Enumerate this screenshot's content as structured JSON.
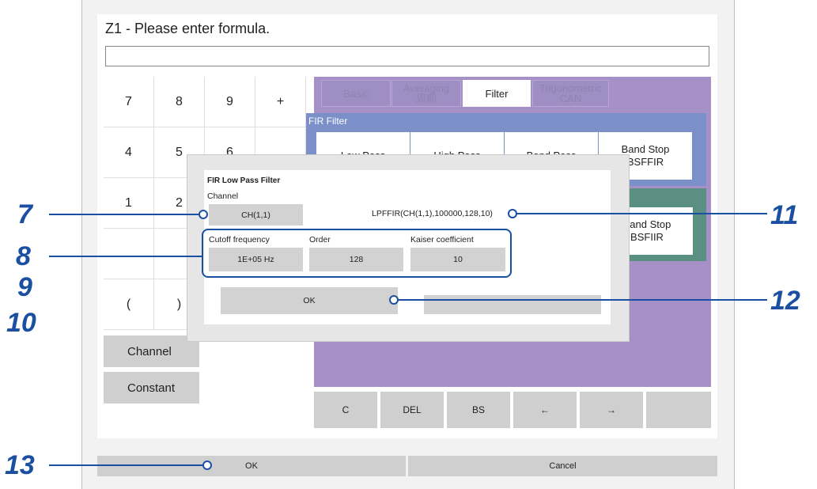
{
  "window": {
    "title": "Z1 - Please enter formula.",
    "formula_value": ""
  },
  "keypad": {
    "keys": [
      "7",
      "8",
      "9",
      "+",
      "4",
      "5",
      "6",
      "",
      "1",
      "2",
      "",
      "",
      "",
      "",
      "",
      "",
      "(",
      ")"
    ]
  },
  "side_buttons": {
    "channel": "Channel",
    "constant": "Constant"
  },
  "tabs": [
    {
      "label": "Basic",
      "active": false
    },
    {
      "label": "Averaging\n周期",
      "active": false
    },
    {
      "label": "Filter",
      "active": true
    },
    {
      "label": "Trigonometric\nCAN",
      "active": false
    }
  ],
  "fir_section": {
    "title": "FIR Filter",
    "buttons": [
      "Low Pass",
      "High Pass",
      "Band Pass",
      "Band Stop\nBSFFIR"
    ]
  },
  "iir_section": {
    "buttons": [
      "Band Stop\nBSFIIR"
    ]
  },
  "bottom_keys": [
    "C",
    "DEL",
    "BS",
    "←",
    "→",
    ""
  ],
  "dialog": {
    "title": "FIR Low Pass Filter",
    "channel_label": "Channel",
    "channel_value": "CH(1,1)",
    "formula_preview": "LPFFIR(CH(1,1),100000,128,10)",
    "cutoff_label": "Cutoff frequency",
    "cutoff_value": "1E+05 Hz",
    "order_label": "Order",
    "order_value": "128",
    "kaiser_label": "Kaiser coefficient",
    "kaiser_value": "10",
    "ok_label": "OK",
    "cancel_label": ""
  },
  "footer": {
    "ok_label": "OK",
    "cancel_label": "Cancel"
  },
  "callouts": {
    "n7": "7",
    "n8": "8",
    "n9": "9",
    "n10": "10",
    "n11": "11",
    "n12": "12",
    "n13": "13"
  },
  "colors": {
    "callout": "#1b4fa1",
    "purple_panel": "#a590c8",
    "fir_panel": "#7b8fc9",
    "iir_panel": "#5a8f82"
  }
}
